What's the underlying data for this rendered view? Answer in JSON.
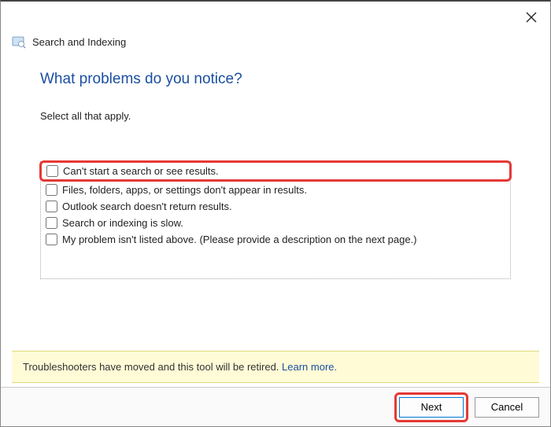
{
  "header": {
    "title": "Search and Indexing"
  },
  "main": {
    "heading": "What problems do you notice?",
    "instruction": "Select all that apply."
  },
  "options": [
    {
      "label": "Can't start a search or see results.",
      "highlighted": true
    },
    {
      "label": "Files, folders, apps, or settings don't appear in results.",
      "highlighted": false
    },
    {
      "label": "Outlook search doesn't return results.",
      "highlighted": false
    },
    {
      "label": "Search or indexing is slow.",
      "highlighted": false
    },
    {
      "label": "My problem isn't listed above. (Please provide a description on the next page.)",
      "highlighted": false
    }
  ],
  "notice": {
    "text": "Troubleshooters have moved and this tool will be retired. ",
    "link_text": "Learn more."
  },
  "buttons": {
    "next": "Next",
    "cancel": "Cancel"
  }
}
